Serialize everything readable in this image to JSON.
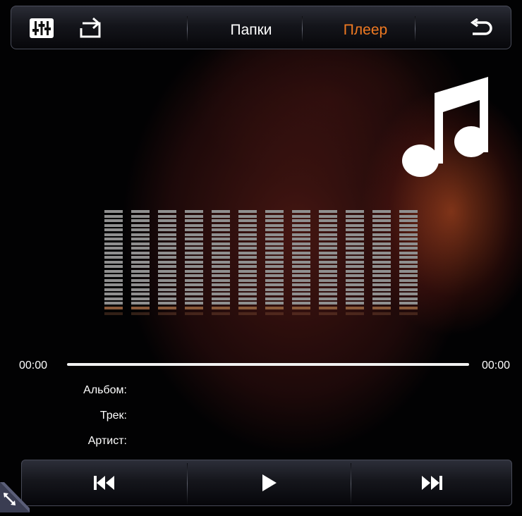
{
  "topbar": {
    "equalizer_icon": "equalizer-icon",
    "repeat_icon": "repeat-icon",
    "tabs": [
      {
        "label": "Папки",
        "color": "#ffffff"
      },
      {
        "label": "Плеер",
        "color": "#f07a22"
      }
    ],
    "back_icon": "back-arrow-icon"
  },
  "album_art_icon": "music-note-icon",
  "player": {
    "time_elapsed": "00:00",
    "time_total": "00:00",
    "progress": 0
  },
  "meta": {
    "album_label": "Альбом:",
    "track_label": "Трек:",
    "artist_label": "Артист:"
  },
  "controls": {
    "prev_icon": "previous-track-icon",
    "play_icon": "play-icon",
    "next_icon": "next-track-icon"
  },
  "corner_icon": "resize-arrows-icon",
  "colors": {
    "accent": "#f07a22",
    "eq_bar": "#8f8f8f",
    "eq_base": "#8a5a3a"
  }
}
